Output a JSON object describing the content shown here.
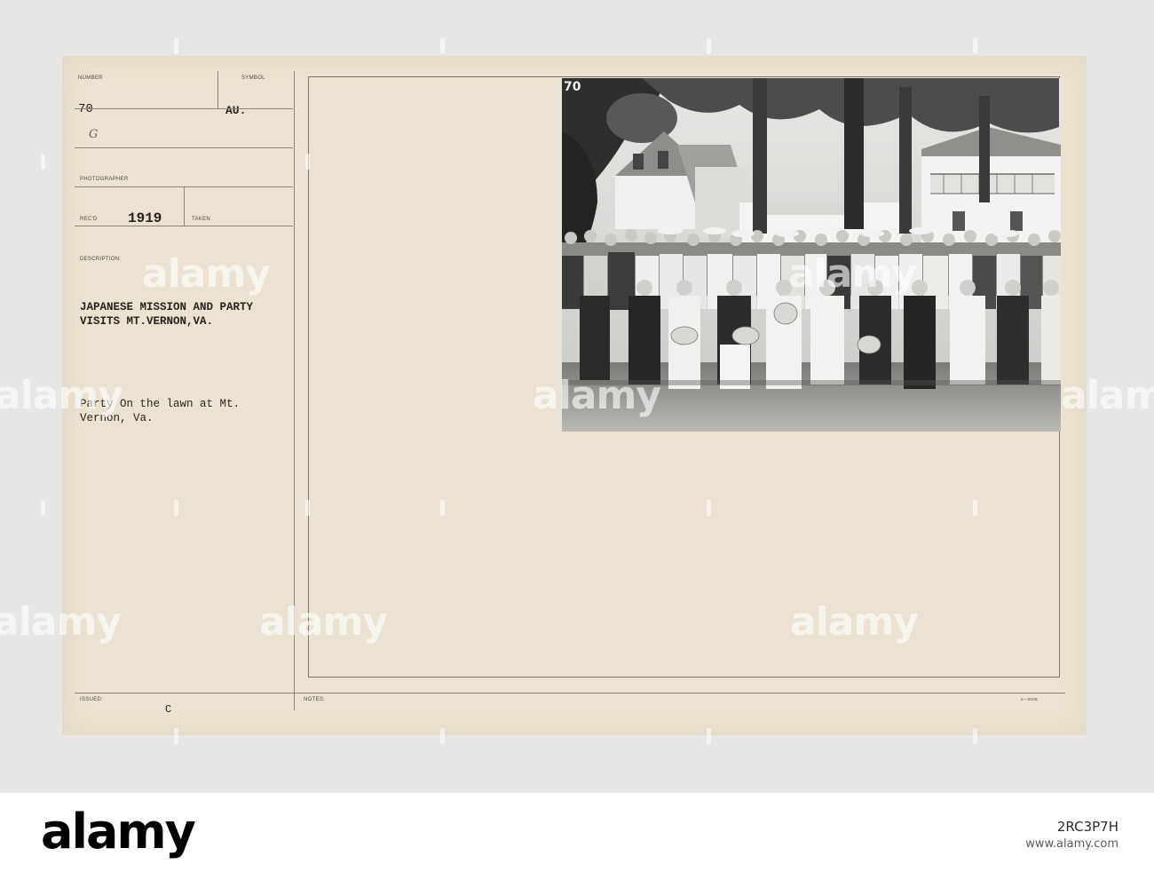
{
  "card": {
    "number_label": "NUMBER",
    "number_value": "70",
    "symbol_label": "SYMBOL",
    "symbol_value": "AU.",
    "handwritten_mark": "G",
    "photographer_label": "PHOTOGRAPHER",
    "recd_label": "REC'D",
    "recd_value": "1919",
    "taken_label": "TAKEN",
    "description_label": "DESCRIPTION:",
    "description_line1": "JAPANESE MISSION AND PARTY",
    "description_line2": "VISITS MT.VERNON,VA.",
    "caption_line1": "Party On the lawn at Mt.",
    "caption_line2": "Vernon, Va.",
    "issued_label": "ISSUED:",
    "issued_value": "C",
    "notes_label": "NOTES:",
    "form_code": "2—3008"
  },
  "photo": {
    "number_overlay": "70",
    "subject": "group-portrait-on-lawn"
  },
  "watermark": {
    "text": "alamy"
  },
  "footer": {
    "logo": "alamy",
    "image_id": "2RC3P7H",
    "site": "www.alamy.com"
  },
  "colors": {
    "card_paper": "#ece2d1",
    "ink": "#26231f",
    "background": "#e7e7e6"
  }
}
